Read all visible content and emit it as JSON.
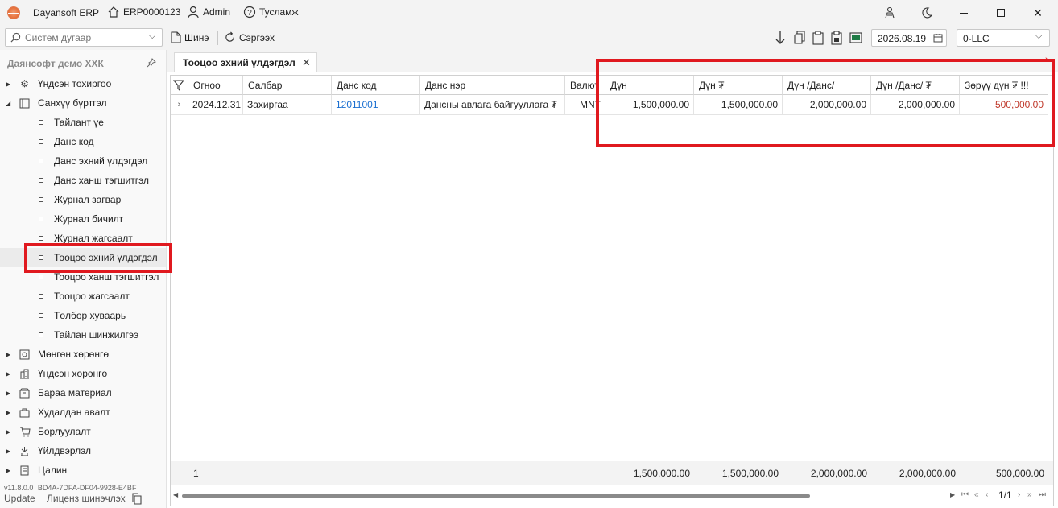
{
  "titlebar": {
    "app_name": "Dayansoft ERP",
    "erp_code": "ERP0000123",
    "user": "Admin",
    "help": "Тусламж"
  },
  "toolbar": {
    "search_placeholder": "Систем дугаар",
    "new_label": "Шинэ",
    "refresh_label": "Сэргээх",
    "date": "2026.08.19",
    "company": "0-LLC"
  },
  "sidebar": {
    "company_name": "Даянсофт демо ХХК",
    "items": [
      {
        "label": "Үндсэн тохиргоо",
        "icon": "gear-icon",
        "expanded": false
      },
      {
        "label": "Санхүү бүртгэл",
        "icon": "book-icon",
        "expanded": true
      },
      {
        "label": "Тайлант үе"
      },
      {
        "label": "Данс код"
      },
      {
        "label": "Данс эхний үлдэгдэл"
      },
      {
        "label": "Данс ханш тэгшитгэл"
      },
      {
        "label": "Журнал загвар"
      },
      {
        "label": "Журнал бичилт"
      },
      {
        "label": "Журнал жагсаалт"
      },
      {
        "label": "Тооцоо эхний үлдэгдэл"
      },
      {
        "label": "Тооцоо ханш тэгшитгэл"
      },
      {
        "label": "Тооцоо жагсаалт"
      },
      {
        "label": "Төлбөр хуваарь"
      },
      {
        "label": "Тайлан шинжилгээ"
      },
      {
        "label": "Мөнгөн хөрөнгө",
        "icon": "safe-icon"
      },
      {
        "label": "Үндсэн хөрөнгө",
        "icon": "building-icon"
      },
      {
        "label": "Бараа материал",
        "icon": "box-icon"
      },
      {
        "label": "Худалдан авалт",
        "icon": "bag-icon"
      },
      {
        "label": "Борлуулалт",
        "icon": "cart-icon"
      },
      {
        "label": "Үйлдвэрлэл",
        "icon": "factory-icon"
      },
      {
        "label": "Цалин",
        "icon": "money-icon"
      }
    ],
    "version": "v11.8.0.0",
    "license_id": "BD4A-7DFA-DF04-9928-E4BF",
    "update_label": "Update",
    "license_update_label": "Лиценз шинэчлэх"
  },
  "tab": {
    "label": "Тооцоо эхний үлдэгдэл"
  },
  "grid": {
    "columns": [
      "Огноо",
      "Салбар",
      "Данс код",
      "Данс нэр",
      "Валют",
      "Дүн",
      "Дүн ₮",
      "Дүн /Данс/",
      "Дүн /Данс/ ₮",
      "Зөрүү дүн ₮ !!!"
    ],
    "rows": [
      [
        "2024.12.31",
        "Захиргаа",
        "12011001",
        "Дансны авлага байгууллага ₮",
        "MNT",
        "1,500,000.00",
        "1,500,000.00",
        "2,000,000.00",
        "2,000,000.00",
        "500,000.00"
      ]
    ],
    "footer": [
      "1",
      "1,500,000.00",
      "1,500,000.00",
      "2,000,000.00",
      "2,000,000.00",
      "500,000.00"
    ],
    "pager": "1/1"
  },
  "colors": {
    "highlight": "#e0191f",
    "link": "#1a6fd0",
    "difference": "#c0392b"
  }
}
